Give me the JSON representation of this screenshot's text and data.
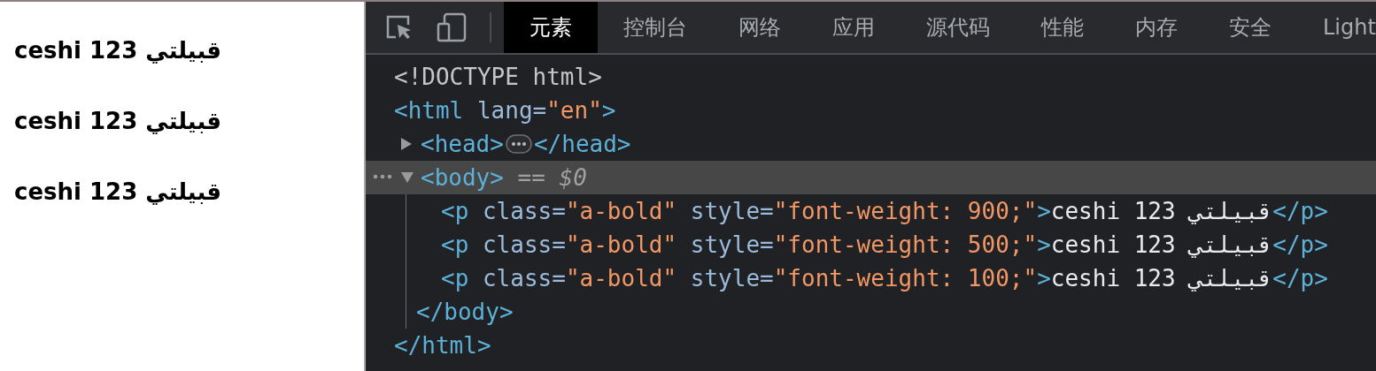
{
  "page_preview": {
    "paragraphs": [
      {
        "text": "ceshi 123 قبيلتي"
      },
      {
        "text": "ceshi 123 قبيلتي"
      },
      {
        "text": "ceshi 123 قبيلتي"
      }
    ]
  },
  "devtools": {
    "tabs": [
      {
        "label": "元素",
        "selected": true
      },
      {
        "label": "控制台",
        "selected": false
      },
      {
        "label": "网络",
        "selected": false
      },
      {
        "label": "应用",
        "selected": false
      },
      {
        "label": "源代码",
        "selected": false
      },
      {
        "label": "性能",
        "selected": false
      },
      {
        "label": "内存",
        "selected": false
      },
      {
        "label": "安全",
        "selected": false
      },
      {
        "label": "Light",
        "selected": false
      }
    ],
    "dom_tree": [
      {
        "selected": false,
        "tokens": [
          {
            "kind": "plain",
            "text": "<!DOCTYPE html>"
          }
        ]
      },
      {
        "selected": false,
        "tokens": [
          {
            "kind": "tag",
            "text": "<html"
          },
          {
            "kind": "attr",
            "text": " lang="
          },
          {
            "kind": "value",
            "text": "\"en\""
          },
          {
            "kind": "tag",
            "text": ">"
          }
        ],
        "children": [
          {
            "selected": false,
            "expanded": false,
            "tokens": [
              {
                "kind": "tag",
                "text": "<head>"
              }
            ],
            "close_tokens": [
              {
                "kind": "tag",
                "text": "</head>"
              }
            ]
          },
          {
            "selected": true,
            "expanded": true,
            "tokens": [
              {
                "kind": "tag",
                "text": "<body>"
              },
              {
                "kind": "op",
                "text": " == "
              },
              {
                "kind": "var",
                "text": "$0"
              }
            ],
            "children": [
              {
                "selected": false,
                "tokens": [
                  {
                    "kind": "tag",
                    "text": "<p"
                  },
                  {
                    "kind": "attr",
                    "text": " class="
                  },
                  {
                    "kind": "value",
                    "text": "\"a-bold\""
                  },
                  {
                    "kind": "attr",
                    "text": " style="
                  },
                  {
                    "kind": "value",
                    "text": "\"font-weight: 900;\""
                  },
                  {
                    "kind": "tag",
                    "text": ">"
                  },
                  {
                    "kind": "text",
                    "text": "ceshi 123 قبيلتي"
                  },
                  {
                    "kind": "tag",
                    "text": "</p>"
                  }
                ]
              },
              {
                "selected": false,
                "tokens": [
                  {
                    "kind": "tag",
                    "text": "<p"
                  },
                  {
                    "kind": "attr",
                    "text": " class="
                  },
                  {
                    "kind": "value",
                    "text": "\"a-bold\""
                  },
                  {
                    "kind": "attr",
                    "text": " style="
                  },
                  {
                    "kind": "value",
                    "text": "\"font-weight: 500;\""
                  },
                  {
                    "kind": "tag",
                    "text": ">"
                  },
                  {
                    "kind": "text",
                    "text": "ceshi 123 قبيلتي"
                  },
                  {
                    "kind": "tag",
                    "text": "</p>"
                  }
                ]
              },
              {
                "selected": false,
                "tokens": [
                  {
                    "kind": "tag",
                    "text": "<p"
                  },
                  {
                    "kind": "attr",
                    "text": " class="
                  },
                  {
                    "kind": "value",
                    "text": "\"a-bold\""
                  },
                  {
                    "kind": "attr",
                    "text": " style="
                  },
                  {
                    "kind": "value",
                    "text": "\"font-weight: 100;\""
                  },
                  {
                    "kind": "tag",
                    "text": ">"
                  },
                  {
                    "kind": "text",
                    "text": "ceshi 123 قبيلتي"
                  },
                  {
                    "kind": "tag",
                    "text": "</p>"
                  }
                ]
              }
            ],
            "close_tokens": [
              {
                "kind": "tag",
                "text": "</body>"
              }
            ]
          }
        ],
        "close_tokens": [
          {
            "kind": "tag",
            "text": "</html>"
          }
        ]
      }
    ]
  }
}
